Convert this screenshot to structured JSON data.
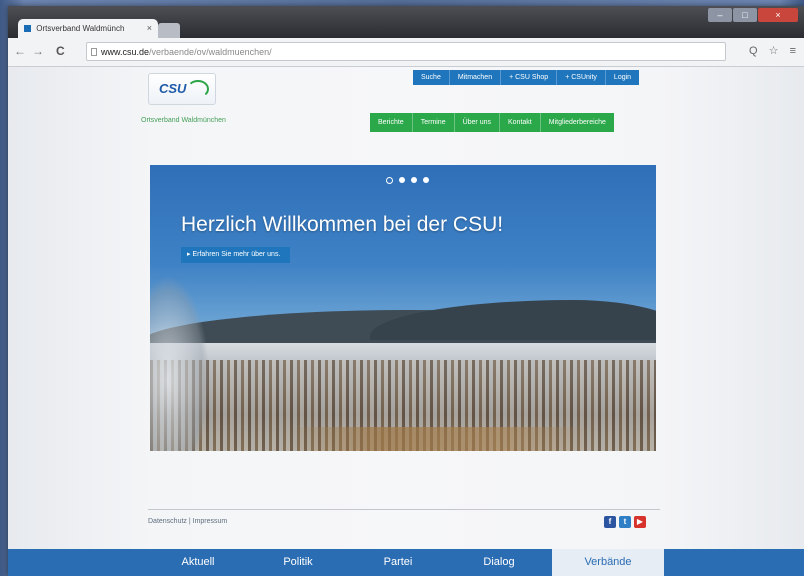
{
  "browser": {
    "tab_title": "Ortsverband Waldmünch",
    "tab_close": "×",
    "url_domain": "www.csu.de",
    "url_path": "/verbaende/ov/waldmuenchen/",
    "back_icon": "←",
    "forward_icon": "→",
    "reload_icon": "C",
    "toolbar_icons": "Q ☆ ≡"
  },
  "site": {
    "logo_text": "CSU",
    "subtitle": "Ortsverband Waldmünchen",
    "top_links": [
      "Suche",
      "Mitmachen",
      "+ CSU Shop",
      "+ CSUnity",
      "Login"
    ],
    "main_nav": [
      "Berichte",
      "Termine",
      "Über uns",
      "Kontakt",
      "Mitgliederbereiche"
    ]
  },
  "hero": {
    "headline": "Herzlich Willkommen bei der CSU!",
    "cta": "▸ Erfahren Sie mehr über uns.",
    "slide_count": 4,
    "active_slide": 1
  },
  "footer": {
    "links": "Datenschutz  |  Impressum",
    "social": [
      "f",
      "t",
      "▶"
    ]
  },
  "bottom_nav": {
    "items": [
      "Aktuell",
      "Politik",
      "Partei",
      "Dialog",
      "Verbände"
    ],
    "active": "Verbände"
  },
  "colors": {
    "csu_blue": "#1f76bd",
    "csu_green": "#2aa84a",
    "bottom_nav": "#2b6db3"
  }
}
